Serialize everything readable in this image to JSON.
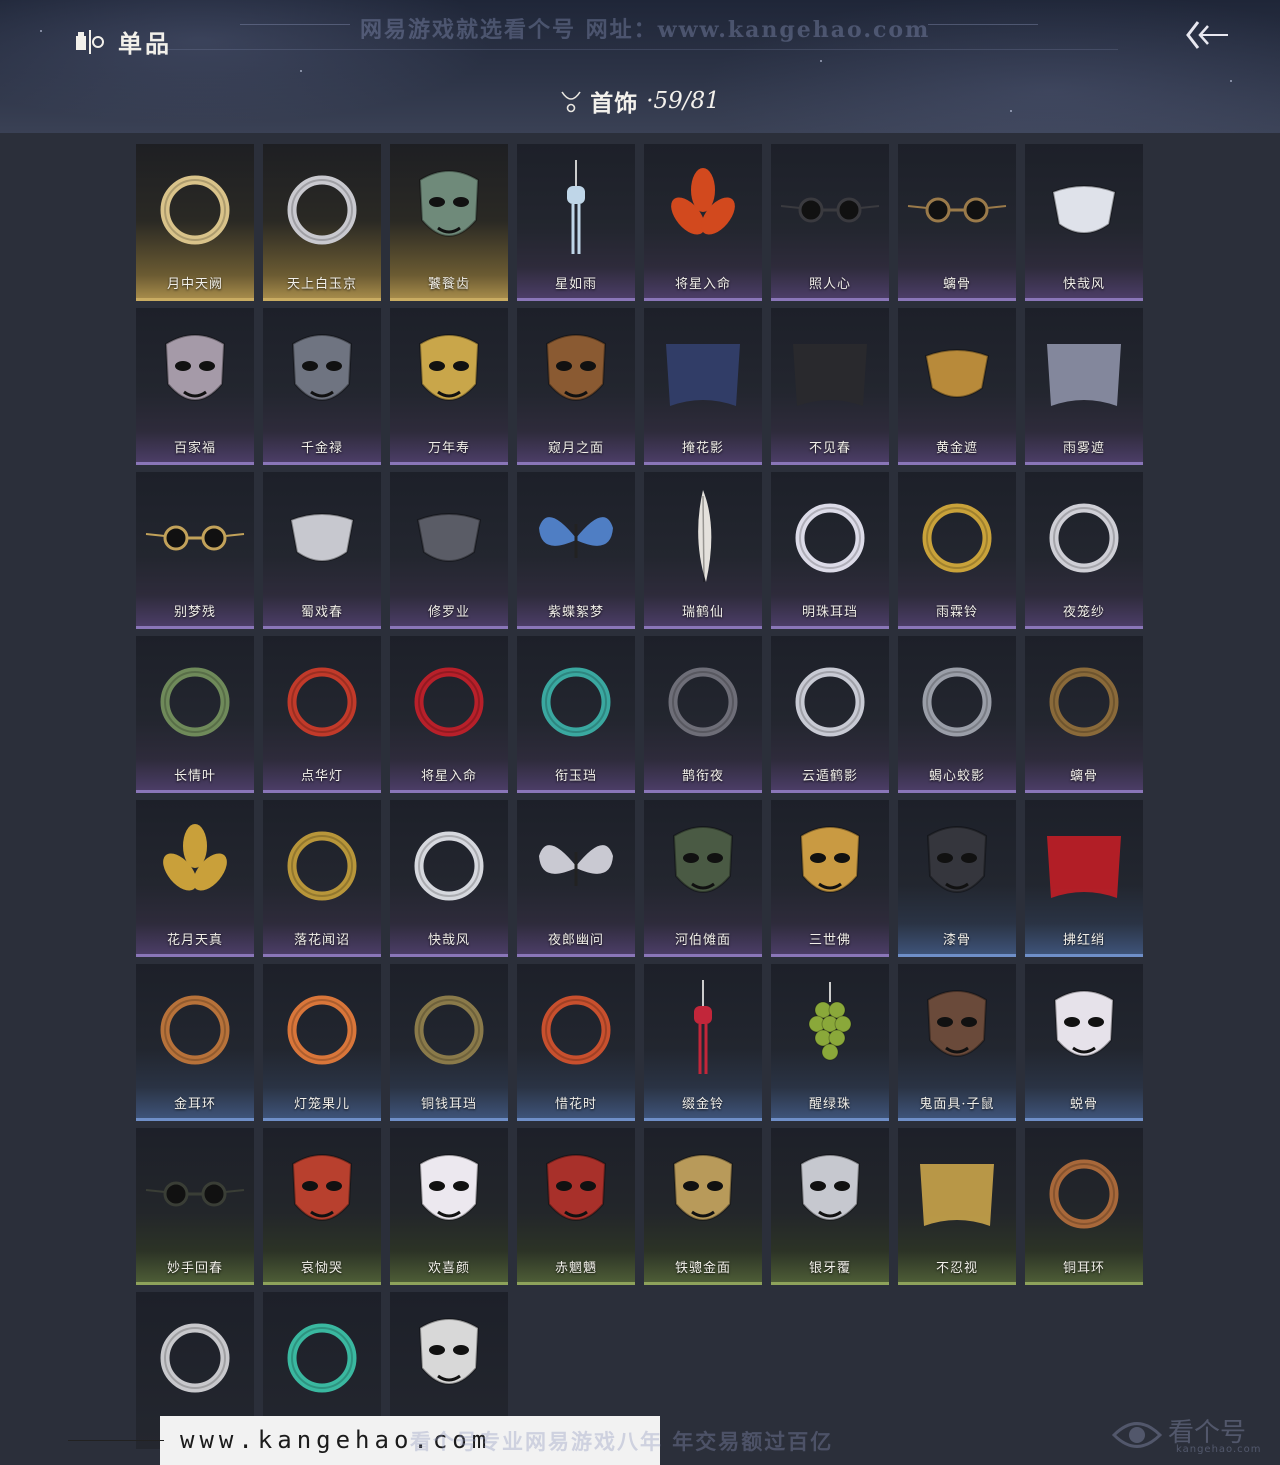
{
  "header": {
    "title": "单品",
    "watermark": "网易游戏就选看个号   网址：www.kangehao.com",
    "category_label": "首饰",
    "category_count": "·59/81"
  },
  "footer": {
    "url": "www.kangehao.com",
    "watermark": "看个号专业网易游戏八年   年交易额过百亿",
    "logo_text": "看个号",
    "logo_sub": "kangehao.com"
  },
  "items": [
    {
      "name": "月中天阙",
      "tier": "gold",
      "icon": "moon-pendant-earring-icon",
      "color": "#d9c38a"
    },
    {
      "name": "天上白玉京",
      "tier": "gold",
      "icon": "silver-drop-earring-icon",
      "color": "#c9c9cf"
    },
    {
      "name": "饕餮齿",
      "tier": "gold",
      "icon": "taotie-mask-icon",
      "color": "#6f8a7a"
    },
    {
      "name": "星如雨",
      "tier": "purple",
      "icon": "crystal-tassel-icon",
      "color": "#bfd6e8"
    },
    {
      "name": "将星入命",
      "tier": "purple",
      "icon": "flame-ornament-icon",
      "color": "#d2491e"
    },
    {
      "name": "照人心",
      "tier": "purple",
      "icon": "round-glasses-icon",
      "color": "#3a3a3f"
    },
    {
      "name": "螭骨",
      "tier": "purple",
      "icon": "bone-glasses-icon",
      "color": "#9a7a4a"
    },
    {
      "name": "快哉风",
      "tier": "purple",
      "icon": "silver-half-mask-icon",
      "color": "#dfe2ea"
    },
    {
      "name": "百家福",
      "tier": "purple",
      "icon": "pink-rat-mask-icon",
      "color": "#a59aa8"
    },
    {
      "name": "千金禄",
      "tier": "purple",
      "icon": "gray-rat-mask-icon",
      "color": "#6f7481"
    },
    {
      "name": "万年寿",
      "tier": "purple",
      "icon": "gold-rat-mask-icon",
      "color": "#c9a64a"
    },
    {
      "name": "窥月之面",
      "tier": "purple",
      "icon": "lion-mask-icon",
      "color": "#8a5a32"
    },
    {
      "name": "掩花影",
      "tier": "purple",
      "icon": "blue-flower-veil-icon",
      "color": "#33406e"
    },
    {
      "name": "不见春",
      "tier": "purple",
      "icon": "black-blindfold-icon",
      "color": "#2a2a2e"
    },
    {
      "name": "黄金遮",
      "tier": "purple",
      "icon": "gold-mouth-mask-icon",
      "color": "#b88a3a"
    },
    {
      "name": "雨雾遮",
      "tier": "purple",
      "icon": "gray-veil-icon",
      "color": "#8e92a8"
    },
    {
      "name": "别梦残",
      "tier": "purple",
      "icon": "monocle-icon",
      "color": "#c2a25a"
    },
    {
      "name": "蜀戏春",
      "tier": "purple",
      "icon": "horned-mouth-mask-icon",
      "color": "#c7c8cf"
    },
    {
      "name": "修罗业",
      "tier": "purple",
      "icon": "iron-half-mask-icon",
      "color": "#5a5c66"
    },
    {
      "name": "紫蝶絮梦",
      "tier": "purple",
      "icon": "blue-butterflies-icon",
      "color": "#4f7ec4"
    },
    {
      "name": "瑞鹤仙",
      "tier": "purple",
      "icon": "white-feather-icon",
      "color": "#e4e1dc"
    },
    {
      "name": "明珠耳珰",
      "tier": "purple",
      "icon": "pearl-earring-icon",
      "color": "#dcdbe8"
    },
    {
      "name": "雨霖铃",
      "tier": "purple",
      "icon": "gold-bell-earring-icon",
      "color": "#c9a23a"
    },
    {
      "name": "夜笼纱",
      "tier": "purple",
      "icon": "silver-tassel-earring-icon",
      "color": "#cfcfd6"
    },
    {
      "name": "长情叶",
      "tier": "purple",
      "icon": "green-leaf-earring-icon",
      "color": "#6f8a5a"
    },
    {
      "name": "点华灯",
      "tier": "purple",
      "icon": "red-lantern-earring-icon",
      "color": "#c23a2a"
    },
    {
      "name": "将星入命",
      "tier": "purple",
      "icon": "red-tassel-earring-icon",
      "color": "#b8202a"
    },
    {
      "name": "衔玉珰",
      "tier": "purple",
      "icon": "jade-hoop-earring-icon",
      "color": "#3aa8a0"
    },
    {
      "name": "鹊衔夜",
      "tier": "purple",
      "icon": "dark-hook-earring-icon",
      "color": "#6e6e78"
    },
    {
      "name": "云遁鹤影",
      "tier": "purple",
      "icon": "silver-feather-earring-icon",
      "color": "#c8cad4"
    },
    {
      "name": "蝎心蛟影",
      "tier": "purple",
      "icon": "silver-plate-earring-icon",
      "color": "#9a9ea8"
    },
    {
      "name": "螭骨",
      "tier": "purple",
      "icon": "bone-hook-earring-icon",
      "color": "#8a6a3a"
    },
    {
      "name": "花月天真",
      "tier": "purple",
      "icon": "gold-flower-ornament-icon",
      "color": "#c9a03a"
    },
    {
      "name": "落花闻诏",
      "tier": "purple",
      "icon": "gold-branch-earring-icon",
      "color": "#b8963a"
    },
    {
      "name": "快哉风",
      "tier": "purple",
      "icon": "white-sword-earring-icon",
      "color": "#d6d8de"
    },
    {
      "name": "夜郎幽问",
      "tier": "purple",
      "icon": "silver-butterfly-icon",
      "color": "#c9c9d2"
    },
    {
      "name": "河伯傩面",
      "tier": "purple",
      "icon": "antler-nuo-mask-icon",
      "color": "#4a5a44"
    },
    {
      "name": "三世佛",
      "tier": "purple",
      "icon": "three-faced-gold-mask-icon",
      "color": "#c99a42"
    },
    {
      "name": "漆骨",
      "tier": "blue",
      "icon": "black-demon-mask-icon",
      "color": "#35363d"
    },
    {
      "name": "拂红绡",
      "tier": "blue",
      "icon": "red-veil-icon",
      "color": "#c21e26"
    },
    {
      "name": "金耳环",
      "tier": "blue",
      "icon": "copper-hoop-icon",
      "color": "#b7723a"
    },
    {
      "name": "灯笼果儿",
      "tier": "blue",
      "icon": "lantern-fruit-earring-icon",
      "color": "#d9763a"
    },
    {
      "name": "铜钱耳珰",
      "tier": "blue",
      "icon": "coin-earring-icon",
      "color": "#8a7a4a"
    },
    {
      "name": "惜花时",
      "tier": "blue",
      "icon": "red-petal-earring-icon",
      "color": "#c8502e"
    },
    {
      "name": "缀金铃",
      "tier": "blue",
      "icon": "gold-bell-tassel-icon",
      "color": "#c2263a"
    },
    {
      "name": "醒绿珠",
      "tier": "blue",
      "icon": "green-grapes-icon",
      "color": "#8aa83a"
    },
    {
      "name": "鬼面具·子鼠",
      "tier": "blue",
      "icon": "rat-demon-mask-icon",
      "color": "#6a4a3a"
    },
    {
      "name": "蜕骨",
      "tier": "blue",
      "icon": "opera-face-mask-icon",
      "color": "#e6e2ea"
    },
    {
      "name": "妙手回春",
      "tier": "green",
      "icon": "dark-spectacles-icon",
      "color": "#3a3e36"
    },
    {
      "name": "哀恸哭",
      "tier": "green",
      "icon": "red-crying-mask-icon",
      "color": "#b8402e"
    },
    {
      "name": "欢喜颜",
      "tier": "green",
      "icon": "white-smiling-mask-icon",
      "color": "#ece8ef"
    },
    {
      "name": "赤魍魉",
      "tier": "green",
      "icon": "red-demon-mask-icon",
      "color": "#a8302a"
    },
    {
      "name": "铁骢金面",
      "tier": "green",
      "icon": "gold-full-face-mask-icon",
      "color": "#b89a5a"
    },
    {
      "name": "银牙覆",
      "tier": "green",
      "icon": "silver-fang-mask-icon",
      "color": "#c6c8cf"
    },
    {
      "name": "不忍视",
      "tier": "green",
      "icon": "gold-crown-veil-icon",
      "color": "#c9a44a"
    },
    {
      "name": "铜耳环",
      "tier": "green",
      "icon": "copper-ring-icon",
      "color": "#a8683a"
    },
    {
      "name": "",
      "tier": "plain",
      "icon": "silver-ring-icon",
      "color": "#c8c8cc"
    },
    {
      "name": "",
      "tier": "plain",
      "icon": "jade-vase-earring-icon",
      "color": "#3ab8a0"
    },
    {
      "name": "",
      "tier": "plain",
      "icon": "cracked-white-mask-icon",
      "color": "#d8d8d8"
    }
  ]
}
